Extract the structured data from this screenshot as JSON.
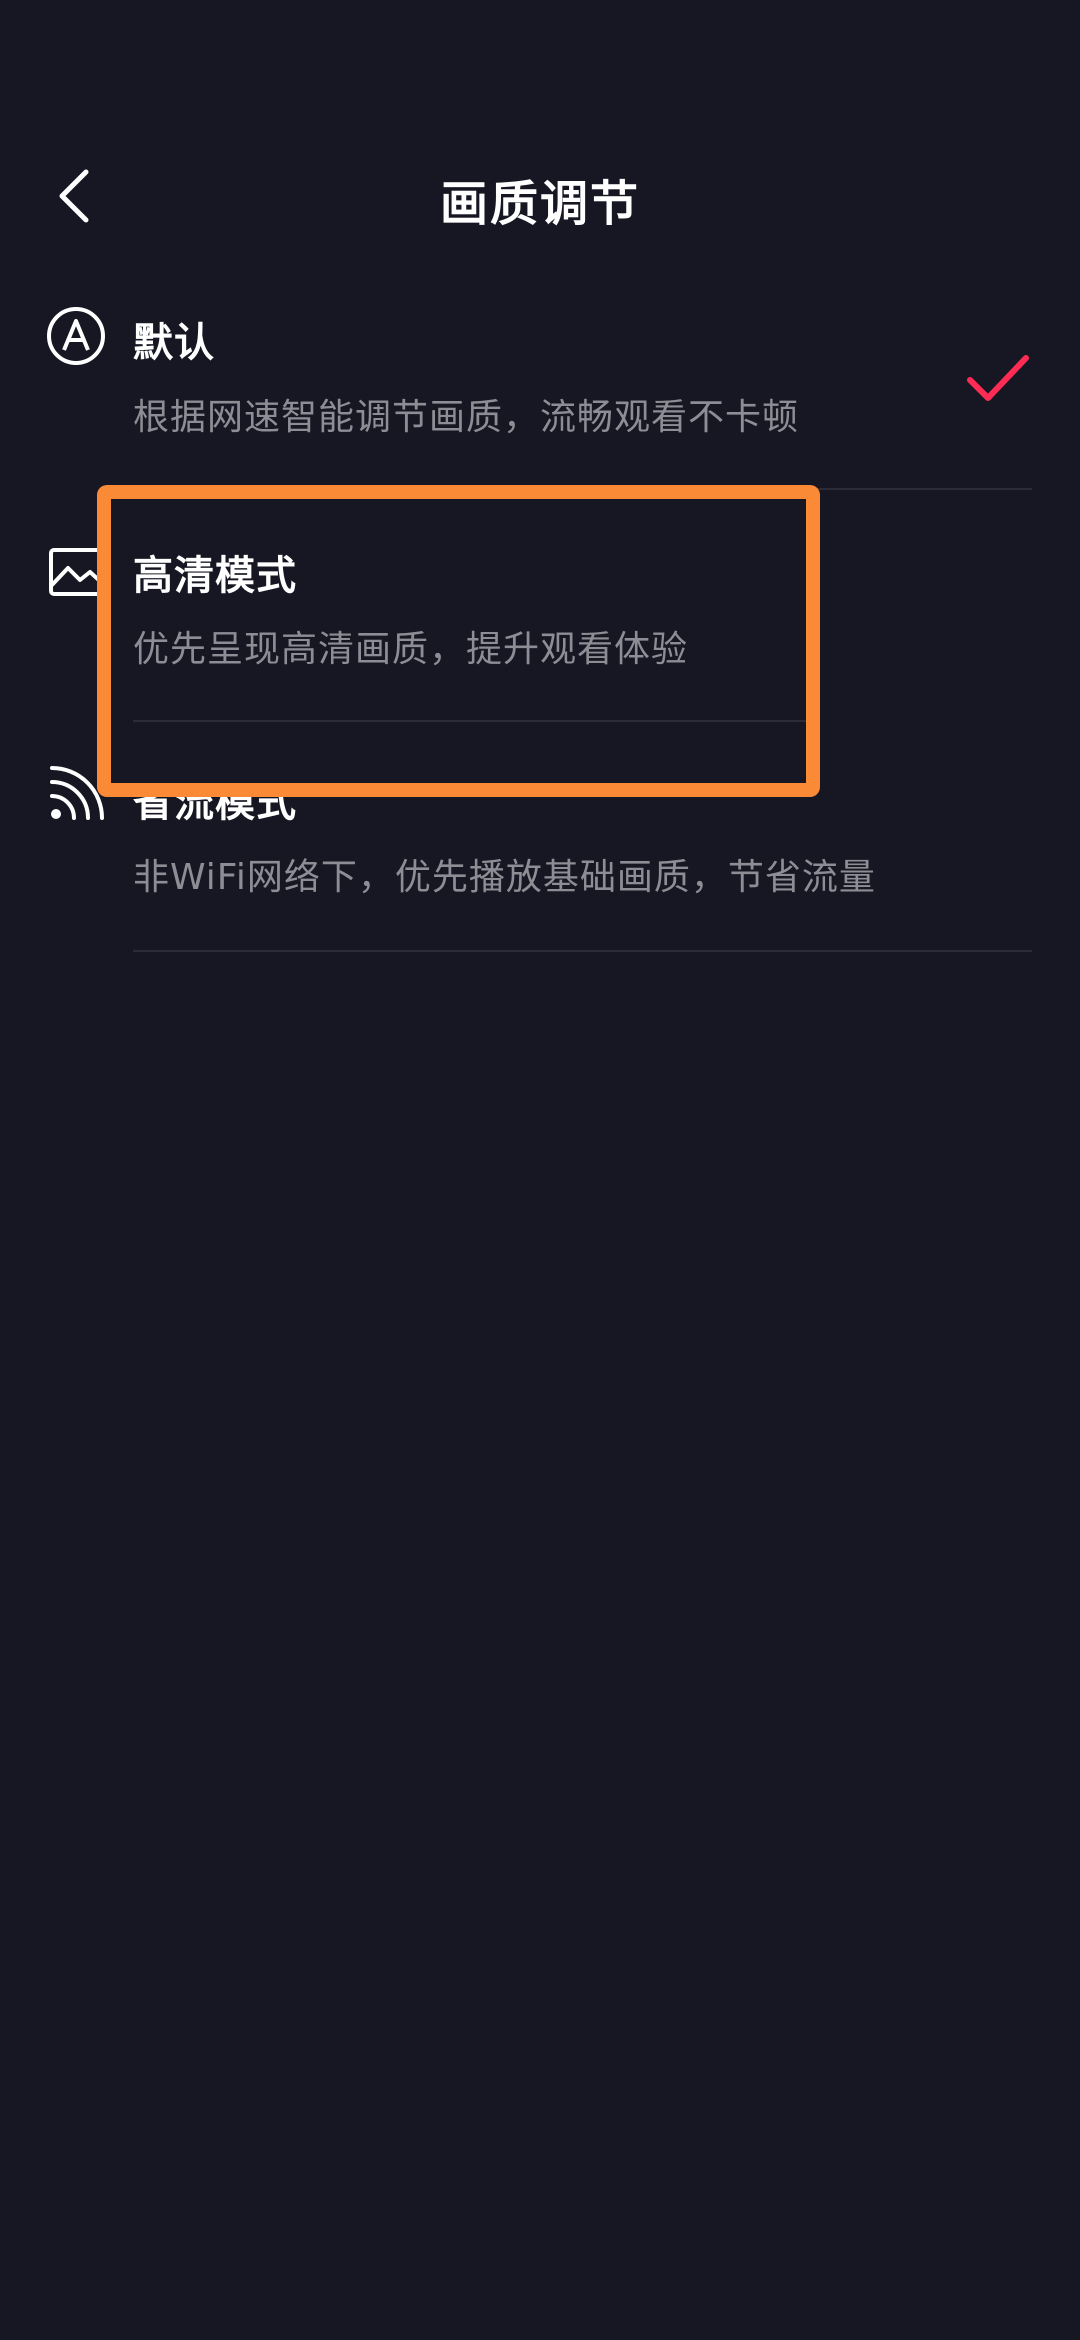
{
  "header": {
    "title": "画质调节",
    "back_icon": "chevron-left-icon"
  },
  "options": [
    {
      "title": "默认",
      "description": "根据网速智能调节画质，流畅观看不卡顿",
      "icon": "auto-a-icon",
      "selected": true
    },
    {
      "title": "高清模式",
      "description": "优先呈现高清画质，提升观看体验",
      "icon": "image-icon",
      "selected": false
    },
    {
      "title": "省流模式",
      "description": "非WiFi网络下，优先播放基础画质，节省流量",
      "icon": "wifi-signal-icon",
      "selected": false
    }
  ],
  "colors": {
    "background": "#161722",
    "check_accent": "#fe2c55",
    "highlight_box": "#fb8a36",
    "secondary_text": "#8d8e95",
    "divider": "#2b2c38"
  }
}
